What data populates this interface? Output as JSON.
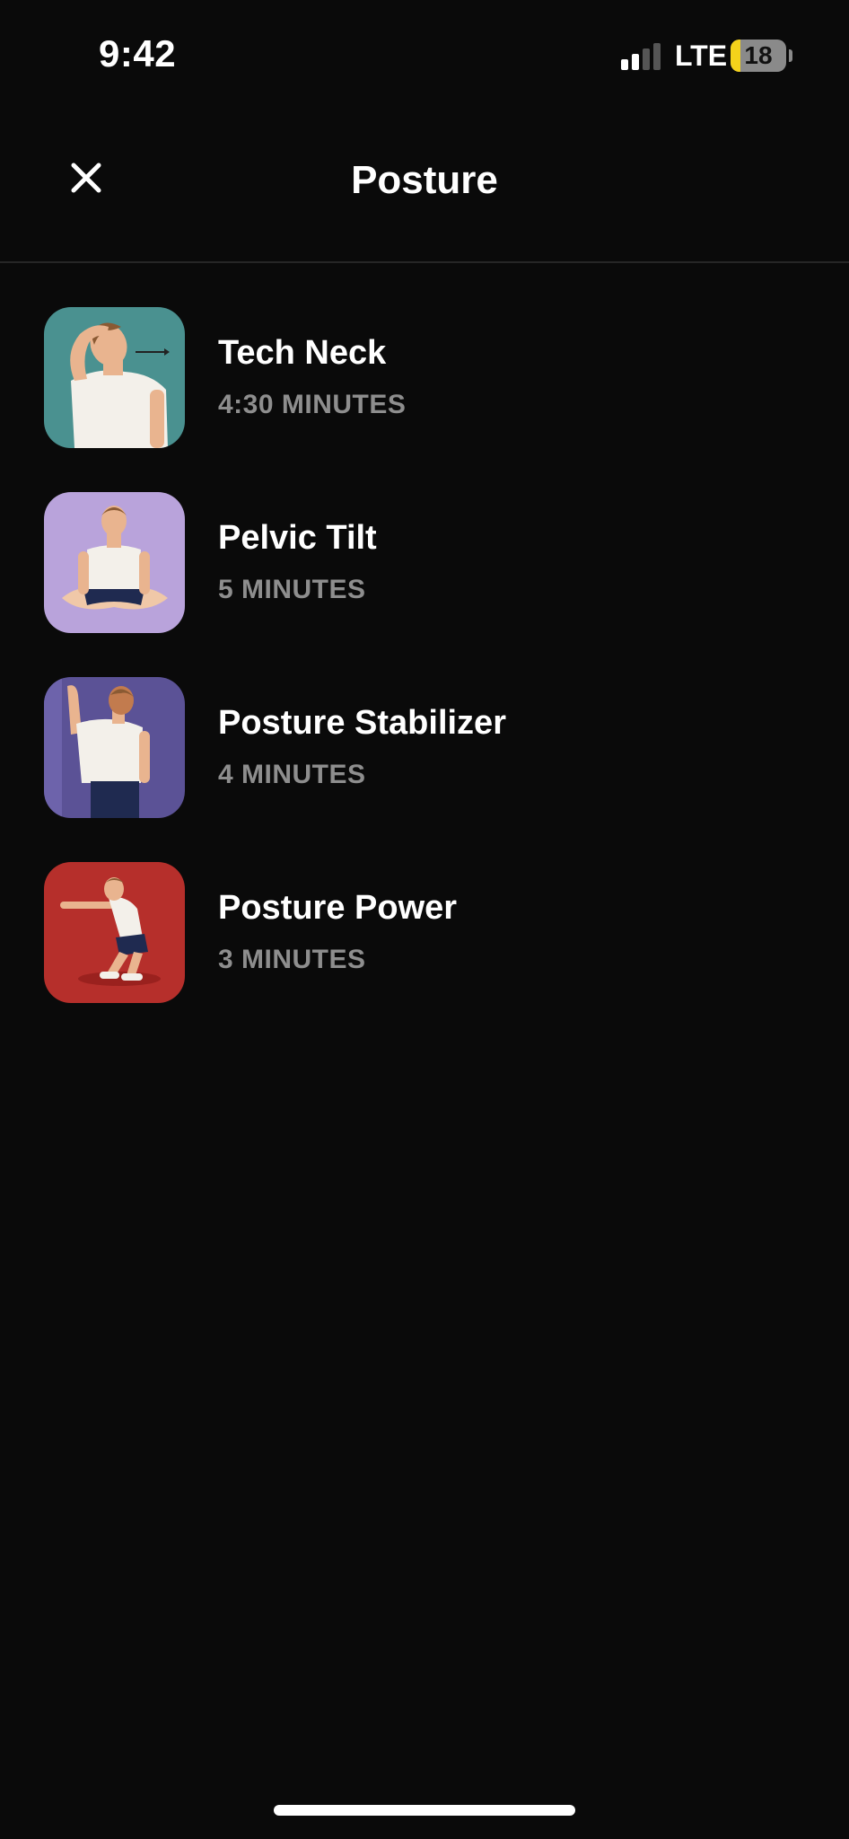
{
  "status_bar": {
    "time": "9:42",
    "network": "LTE",
    "battery_level": "18",
    "battery_fraction": 0.18,
    "signal_bars_active": 2,
    "signal_bars_total": 4
  },
  "header": {
    "title": "Posture",
    "close_icon": "close-icon"
  },
  "workouts": [
    {
      "title": "Tech Neck",
      "duration": "4:30 MINUTES",
      "thumb_color": "#4a9190",
      "icon": "neck-stretch-illustration"
    },
    {
      "title": "Pelvic Tilt",
      "duration": "5 MINUTES",
      "thumb_color": "#b9a3db",
      "icon": "seated-stretch-illustration"
    },
    {
      "title": "Posture Stabilizer",
      "duration": "4 MINUTES",
      "thumb_color": "#5b5296",
      "icon": "wall-stretch-illustration"
    },
    {
      "title": "Posture Power",
      "duration": "3 MINUTES",
      "thumb_color": "#b62f2b",
      "icon": "squat-illustration"
    }
  ],
  "colors": {
    "background": "#0a0a0a",
    "text_primary": "#ffffff",
    "text_secondary": "#8e8e8e",
    "battery_fill": "#f4d21b"
  }
}
